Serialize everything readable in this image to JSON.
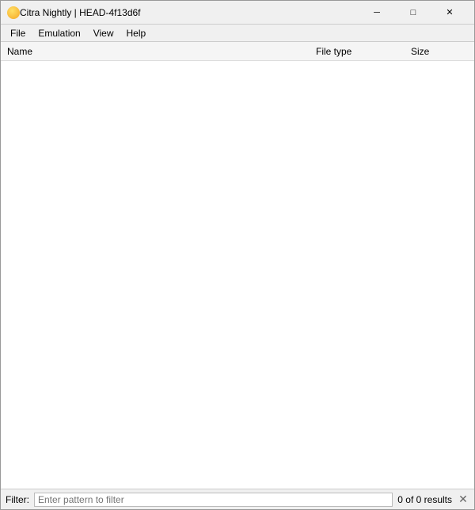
{
  "titleBar": {
    "title": "Citra Nightly | HEAD-4f13d6f",
    "minimizeLabel": "─",
    "maximizeLabel": "□",
    "closeLabel": "✕"
  },
  "menuBar": {
    "items": [
      {
        "label": "File"
      },
      {
        "label": "Emulation"
      },
      {
        "label": "View"
      },
      {
        "label": "Help"
      }
    ]
  },
  "columnHeaders": {
    "name": "Name",
    "fileType": "File type",
    "size": "Size"
  },
  "statusBar": {
    "filterLabel": "Filter:",
    "filterPlaceholder": "Enter pattern to filter",
    "resultsCount": "0 of 0 results",
    "clearLabel": "✕"
  }
}
